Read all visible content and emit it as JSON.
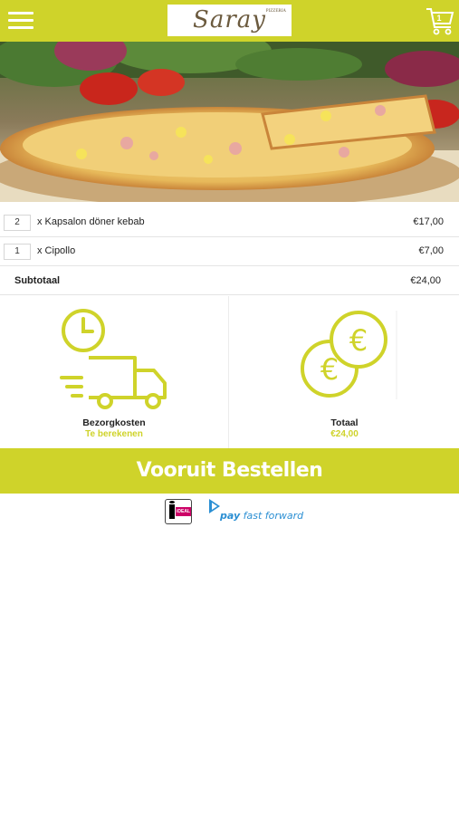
{
  "header": {
    "logo_text": "Saray",
    "logo_sup": "PIZZERIA",
    "cart_count": "1"
  },
  "order": {
    "items": [
      {
        "qty": "2",
        "name": "x Kapsalon döner kebab",
        "price": "€17,00"
      },
      {
        "qty": "1",
        "name": "x Cipollo",
        "price": "€7,00"
      }
    ],
    "subtotal_label": "Subtotaal",
    "subtotal_value": "€24,00"
  },
  "summary": {
    "delivery_label": "Bezorgkosten",
    "delivery_value": "Te berekenen",
    "total_label": "Totaal",
    "total_value": "€24,00"
  },
  "order_button_label": "Vooruit Bestellen",
  "payments": {
    "ideal_label": "iDEAL",
    "pff_label_bold": "pay",
    "pff_label_rest": " fast forward"
  },
  "colors": {
    "brand": "#cfd32a",
    "pff": "#2b8fd3"
  },
  "icons": {
    "menu": "hamburger-menu-icon",
    "cart": "shopping-cart-icon",
    "delivery": "delivery-truck-clock-icon",
    "total": "euro-coins-icon"
  }
}
